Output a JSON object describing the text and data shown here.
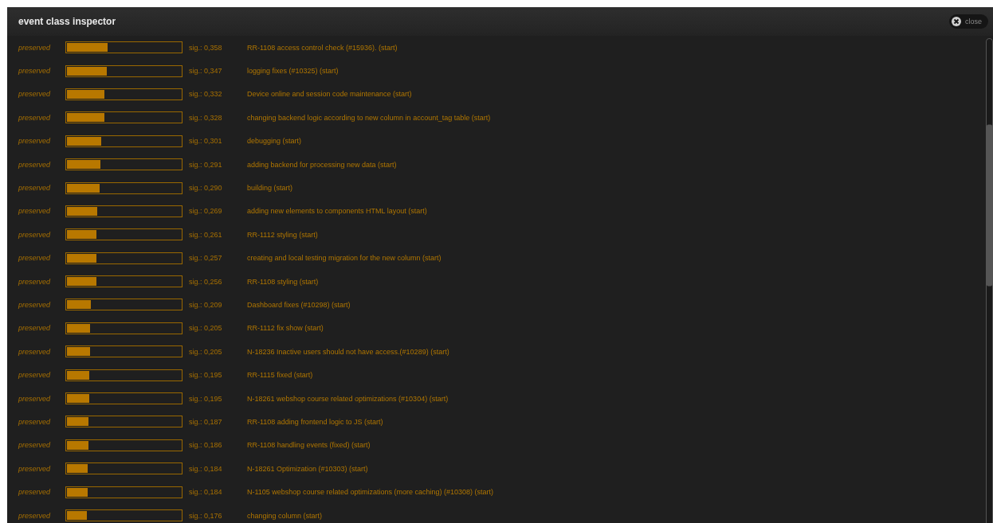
{
  "window": {
    "title": "event class inspector",
    "close_label": "close"
  },
  "rows": [
    {
      "status": "preserved",
      "level": 0.358,
      "sig": "sig.: 0,358",
      "description": "RR-1108 access control check (#15936). (start)"
    },
    {
      "status": "preserved",
      "level": 0.347,
      "sig": "sig.: 0,347",
      "description": "logging fixes (#10325) (start)"
    },
    {
      "status": "preserved",
      "level": 0.332,
      "sig": "sig.: 0,332",
      "description": "Device online and session code maintenance (start)"
    },
    {
      "status": "preserved",
      "level": 0.328,
      "sig": "sig.: 0,328",
      "description": "changing backend logic according to new column in account_tag table (start)"
    },
    {
      "status": "preserved",
      "level": 0.301,
      "sig": "sig.: 0,301",
      "description": "debugging (start)"
    },
    {
      "status": "preserved",
      "level": 0.291,
      "sig": "sig.: 0,291",
      "description": "adding backend for processing new data (start)"
    },
    {
      "status": "preserved",
      "level": 0.29,
      "sig": "sig.: 0,290",
      "description": "building (start)"
    },
    {
      "status": "preserved",
      "level": 0.269,
      "sig": "sig.: 0,269",
      "description": "adding new elements to components HTML layout (start)"
    },
    {
      "status": "preserved",
      "level": 0.261,
      "sig": "sig.: 0,261",
      "description": "RR-1112 styling (start)"
    },
    {
      "status": "preserved",
      "level": 0.257,
      "sig": "sig.: 0,257",
      "description": "creating and local testing migration for the new column (start)"
    },
    {
      "status": "preserved",
      "level": 0.256,
      "sig": "sig.: 0,256",
      "description": "RR-1108 styling (start)"
    },
    {
      "status": "preserved",
      "level": 0.209,
      "sig": "sig.: 0,209",
      "description": "Dashboard  fixes (#10298) (start)"
    },
    {
      "status": "preserved",
      "level": 0.205,
      "sig": "sig.: 0,205",
      "description": "RR-1112 fix show (start)"
    },
    {
      "status": "preserved",
      "level": 0.205,
      "sig": "sig.: 0,205",
      "description": "N-18236 Inactive users should not have access.(#10289) (start)"
    },
    {
      "status": "preserved",
      "level": 0.195,
      "sig": "sig.: 0,195",
      "description": "RR-1115 fixed (start)"
    },
    {
      "status": "preserved",
      "level": 0.195,
      "sig": "sig.: 0,195",
      "description": "N-18261 webshop course related optimizations (#10304) (start)"
    },
    {
      "status": "preserved",
      "level": 0.187,
      "sig": "sig.: 0,187",
      "description": "RR-1108 adding frontend logic to JS (start)"
    },
    {
      "status": "preserved",
      "level": 0.186,
      "sig": "sig.: 0,186",
      "description": "RR-1108 handling events (fixed) (start)"
    },
    {
      "status": "preserved",
      "level": 0.184,
      "sig": "sig.: 0,184",
      "description": "N-18261 Optimization (#10303) (start)"
    },
    {
      "status": "preserved",
      "level": 0.184,
      "sig": "sig.: 0,184",
      "description": "N-1105  webshop course related optimizations (more caching) (#10308) (start)"
    },
    {
      "status": "preserved",
      "level": 0.176,
      "sig": "sig.: 0,176",
      "description": "changing column (start)"
    }
  ]
}
